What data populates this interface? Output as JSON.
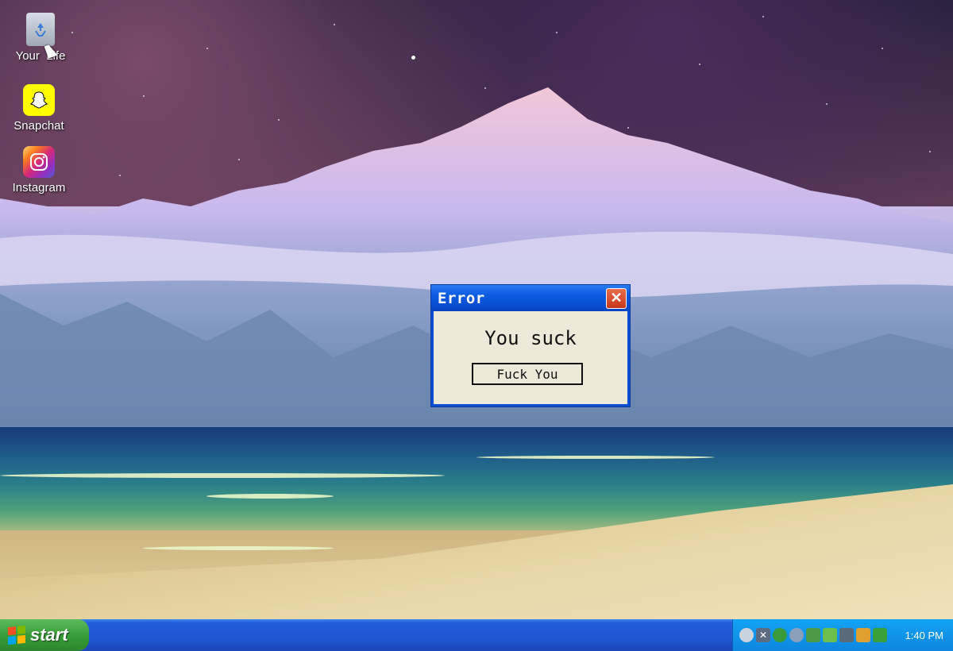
{
  "desktop": {
    "icons": [
      {
        "label": "Your  Life",
        "icon": "recycle-bin-icon"
      },
      {
        "label": "Snapchat",
        "icon": "snapchat-icon"
      },
      {
        "label": "Instagram",
        "icon": "instagram-icon"
      }
    ]
  },
  "dialog": {
    "title": "Error",
    "message": "You suck",
    "button_label": "Fuck You",
    "close_glyph": "✕"
  },
  "taskbar": {
    "start_label": "start",
    "clock": "1:40 PM",
    "tray_icons": [
      "network-icon",
      "alert-icon",
      "security-icon",
      "volume-icon",
      "display-icon",
      "update-icon",
      "monitor-icon",
      "pen-icon",
      "power-icon"
    ]
  },
  "colors": {
    "taskbar_blue": "#245edb",
    "start_green": "#379d37",
    "tray_blue": "#0d86e0",
    "dialog_title_blue": "#0a5ae0",
    "close_red": "#c7371a"
  }
}
